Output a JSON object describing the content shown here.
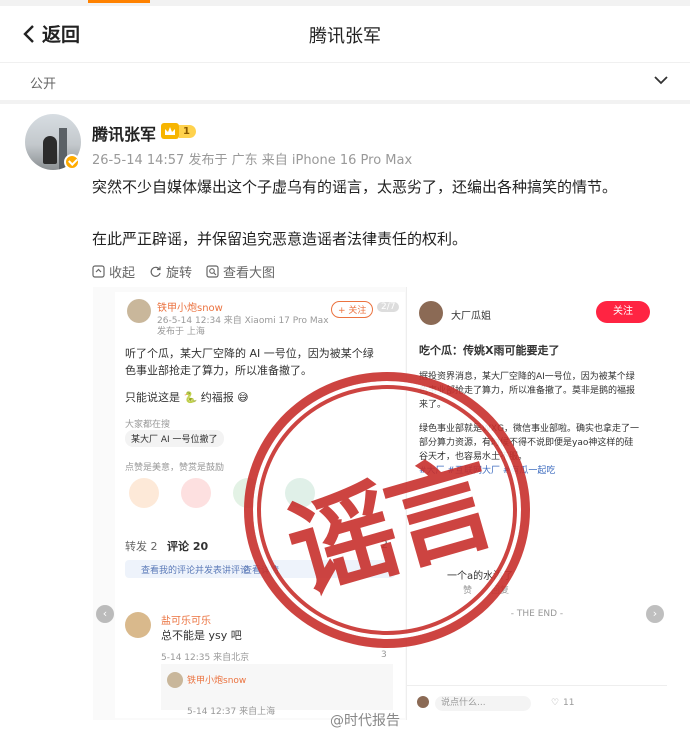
{
  "nav": {
    "back_label": "返回",
    "title": "腾讯张军"
  },
  "visibility": {
    "label": "公开"
  },
  "post": {
    "author": "腾讯张军",
    "level": "1",
    "meta": "26-5-14 14:57 发布于 广东 来自 iPhone 16 Pro Max",
    "text1": "突然不少自媒体爆出这个子虚乌有的谣言，太恶劣了，还编出各种搞笑的情节。",
    "text2": "在此严正辟谣，并保留追究恶意造谣者法律责任的权利。",
    "tools": {
      "collect": "收起",
      "rotate": "旋转",
      "view_large": "查看大图"
    }
  },
  "image": {
    "left": {
      "user": "铁甲小炮snow",
      "follow": "+ 关注",
      "page": "2/7",
      "time": "26-5-14 12:34 来自 Xiaomi 17 Pro Max",
      "location": "发布于 上海",
      "line1": "听了个瓜，某大厂空降的 AI 一号位，因为被某个绿",
      "line2": "色事业部抢走了算力，所以准备撤了。",
      "line3": "只能说这是 🐍 约福报 😅",
      "search_hint": "大家都在搜",
      "search": "某大厂 AI 一号位撤了",
      "reactions_hint": "点赞是美意，赞赏是鼓励",
      "reposts": "转发 2",
      "comments": "评论 20",
      "comment_count": "2",
      "comment_tip": "查看我的评论并发表讲评论",
      "comment_tip_action": "查看详情",
      "c1_user": "盐可乐可乐",
      "c1_text": "总不能是 ysy 吧",
      "c1_time": "5-14 12:35 来自北京",
      "c1_likes": "3",
      "c2_user": "铁甲小炮snow",
      "c2_time": "5-14 12:37 来自上海"
    },
    "right": {
      "user": "大厂瓜姐",
      "follow": "关注",
      "title": "吃个瓜：传姚X雨可能要走了",
      "body1": "据投资界消息，某大厂空降的AI一号位，因为被某个绿",
      "body2": "色事业部抢走了算力，所以准备撤了。莫非是鹅的福报",
      "body3": "来了。",
      "body4": "绿色事业部就是WXG，微信事业部啦。确实也拿走了一",
      "body5": "部分算力资源，有时候不得不说即便是yao神这样的硅",
      "body6": "谷天才，也容易水土不服。",
      "tags": "#大厂 #互联网大厂 #有瓜一起吃",
      "reply": "一个a的水漂了",
      "reply_like": "赞",
      "reply_reply": "回复",
      "end": "- THE END -",
      "input_placeholder": "说点什么...",
      "likes": "11"
    },
    "stamp": "谣言"
  },
  "watermark": "@时代报告",
  "colors": {
    "accent": "#ff8200",
    "stamp": "#c8302d",
    "follow_btn": "#ff2442",
    "link": "#eb7340"
  }
}
